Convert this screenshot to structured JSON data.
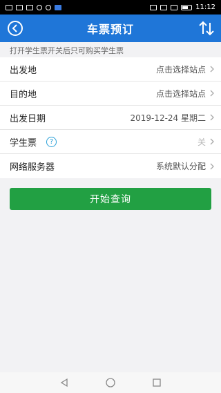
{
  "status_bar": {
    "left_icons": [
      "sim-icon",
      "signal-icon",
      "wifi-icon",
      "clock-icon",
      "message-icon",
      "notification-icon"
    ],
    "battery_text": "",
    "time": "11:12"
  },
  "header": {
    "title": "车票预订"
  },
  "hint": "打开学生票开关后只可购买学生票",
  "rows": [
    {
      "label": "出发地",
      "value": "点击选择站点"
    },
    {
      "label": "目的地",
      "value": "点击选择站点"
    },
    {
      "label": "出发日期",
      "value": "2019-12-24 星期二"
    },
    {
      "label": "学生票",
      "value": "关",
      "help": "?"
    },
    {
      "label": "网络服务器",
      "value": "系统默认分配"
    }
  ],
  "query_button": "开始查询",
  "colors": {
    "header": "#1f76d8",
    "button": "#22a043",
    "background": "#f2f2f4"
  }
}
